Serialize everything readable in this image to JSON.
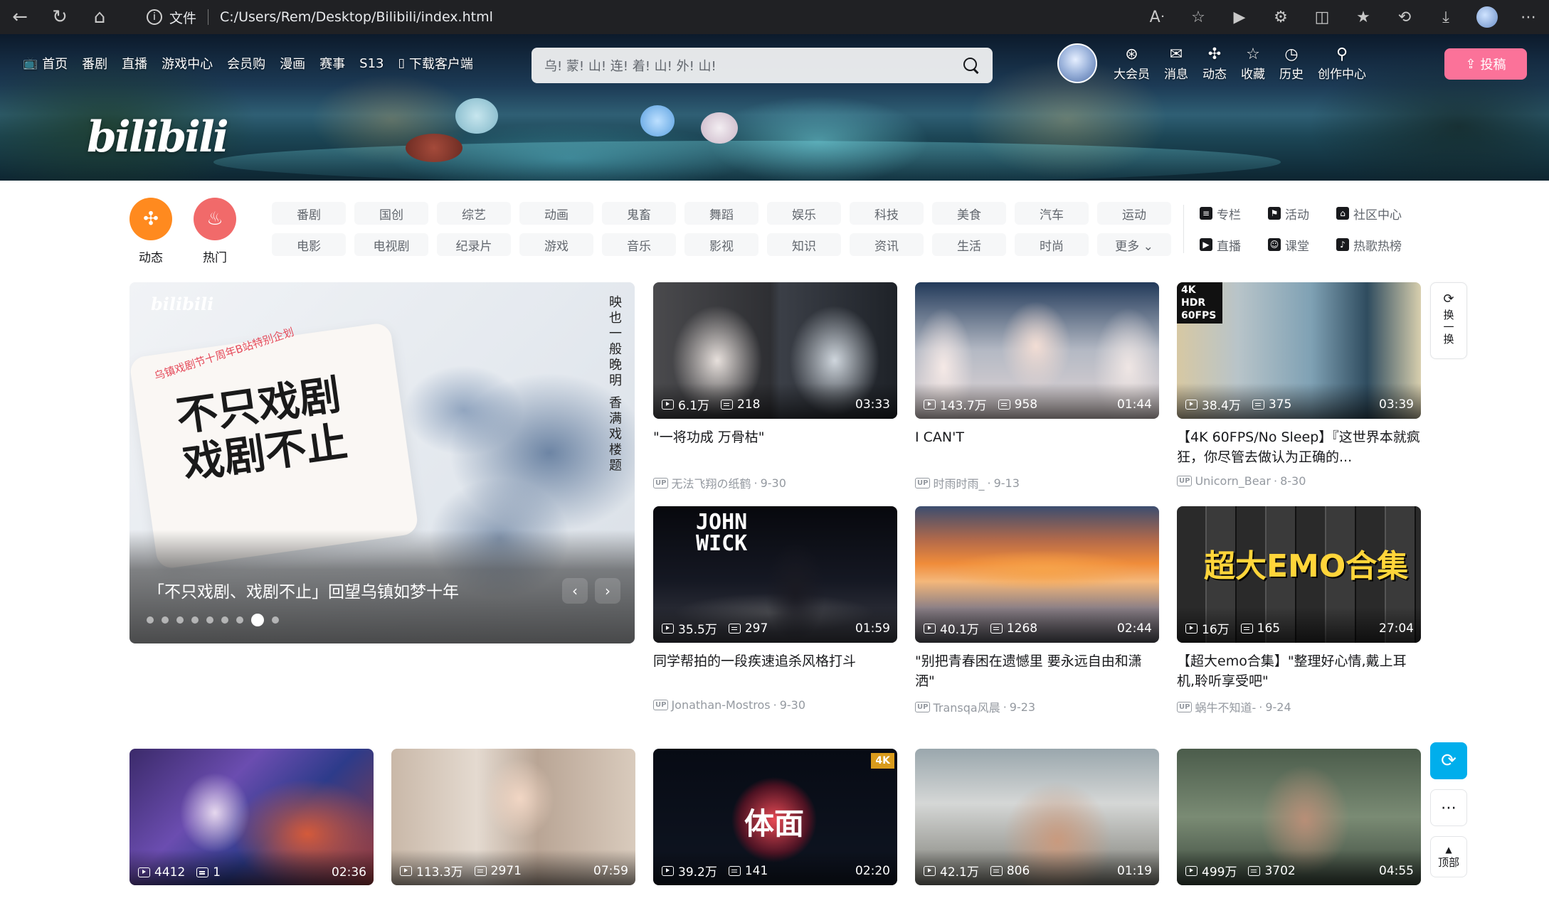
{
  "browser": {
    "file_label": "文件",
    "address": "C:/Users/Rem/Desktop/Bilibili/index.html"
  },
  "header": {
    "nav_left": [
      {
        "label": "首页",
        "icon": "tv-icon"
      },
      {
        "label": "番剧"
      },
      {
        "label": "直播"
      },
      {
        "label": "游戏中心"
      },
      {
        "label": "会员购"
      },
      {
        "label": "漫画"
      },
      {
        "label": "赛事"
      },
      {
        "label": "S13"
      },
      {
        "label": "下载客户端",
        "icon": "phone-icon"
      }
    ],
    "search_placeholder": "乌! 蒙! 山! 连! 着! 山! 外! 山!",
    "nav_right": [
      {
        "label": "大会员",
        "icon": "vip-icon"
      },
      {
        "label": "消息",
        "icon": "message-icon"
      },
      {
        "label": "动态",
        "icon": "dynamic-icon"
      },
      {
        "label": "收藏",
        "icon": "star-icon"
      },
      {
        "label": "历史",
        "icon": "clock-icon"
      },
      {
        "label": "创作中心",
        "icon": "bulb-icon"
      }
    ],
    "upload_label": "投稿",
    "logo_text": "bilibili"
  },
  "channel": {
    "dynamic_label": "动态",
    "hot_label": "热门",
    "chips": [
      "番剧",
      "国创",
      "综艺",
      "动画",
      "鬼畜",
      "舞蹈",
      "娱乐",
      "科技",
      "美食",
      "汽车",
      "运动",
      "电影",
      "电视剧",
      "纪录片",
      "游戏",
      "音乐",
      "影视",
      "知识",
      "资讯",
      "生活",
      "时尚",
      "更多 ⌄"
    ],
    "extras": [
      {
        "label": "专栏",
        "icon": "column-icon"
      },
      {
        "label": "活动",
        "icon": "flag-icon"
      },
      {
        "label": "社区中心",
        "icon": "community-icon"
      },
      {
        "label": "直播",
        "icon": "live-icon"
      },
      {
        "label": "课堂",
        "icon": "class-icon"
      },
      {
        "label": "热歌热榜",
        "icon": "music-chart-icon"
      }
    ]
  },
  "carousel": {
    "title": "「不只戏剧、戏剧不止」回望乌镇如梦十年",
    "art_text_1": "不只戏剧",
    "art_text_2": "戏剧不止",
    "art_red": "乌镇戏剧节十周年B站特别企划",
    "vertical_text": "映也一般晚明 香满戏楼题",
    "brand": "bilibili",
    "dots_total": 9,
    "active_dot": 7
  },
  "videos": [
    {
      "title": "\"一将功成 万骨枯\"",
      "views": "6.1万",
      "danmaku": "218",
      "duration": "03:33",
      "owner": "无法飞翔の纸鹤",
      "date": "9-30"
    },
    {
      "title": "I CAN'T",
      "views": "143.7万",
      "danmaku": "958",
      "duration": "01:44",
      "owner": "时雨时雨_",
      "date": "9-13"
    },
    {
      "title": "【4K 60FPS/No Sleep】『这世界本就疯狂，你尽管去做认为正确的...",
      "views": "38.4万",
      "danmaku": "375",
      "duration": "03:39",
      "owner": "Unicorn_Bear",
      "date": "8-30"
    },
    {
      "title": "同学帮拍的一段疾速追杀风格打斗",
      "views": "35.5万",
      "danmaku": "297",
      "duration": "01:59",
      "owner": "Jonathan-Mostros",
      "date": "9-30"
    },
    {
      "title": "\"别把青春困在遗憾里 要永远自由和潇洒\"",
      "views": "40.1万",
      "danmaku": "1268",
      "duration": "02:44",
      "owner": "Transqa风晨",
      "date": "9-23"
    },
    {
      "title": "【超大emo合集】\"整理好心情,戴上耳机,聆听享受吧\"",
      "views": "16万",
      "danmaku": "165",
      "duration": "27:04",
      "owner": "蜗牛不知道-",
      "date": "9-24"
    },
    {
      "title": "",
      "views": "4412",
      "danmaku": "1",
      "duration": "02:36"
    },
    {
      "title": "",
      "views": "113.3万",
      "danmaku": "2971",
      "duration": "07:59"
    },
    {
      "title": "",
      "views": "39.2万",
      "danmaku": "141",
      "duration": "02:20"
    },
    {
      "title": "",
      "views": "42.1万",
      "danmaku": "806",
      "duration": "01:19"
    },
    {
      "title": "",
      "views": "499万",
      "danmaku": "3702",
      "duration": "04:55"
    }
  ],
  "thumb_overlays": {
    "wick_text": "JOHN WICK",
    "emo_text": "超大EMO合集",
    "hdr_badge": "4K HDR 60FPS",
    "music_text": "体面",
    "music_badge": "4K"
  },
  "side": {
    "refresh_label": "换一换",
    "top_label": "顶部"
  },
  "colors": {
    "brand_pink": "#fb7299",
    "brand_blue": "#00aeec",
    "dynamic_orange": "#ff8a1f",
    "hot_red": "#f16a6a"
  }
}
